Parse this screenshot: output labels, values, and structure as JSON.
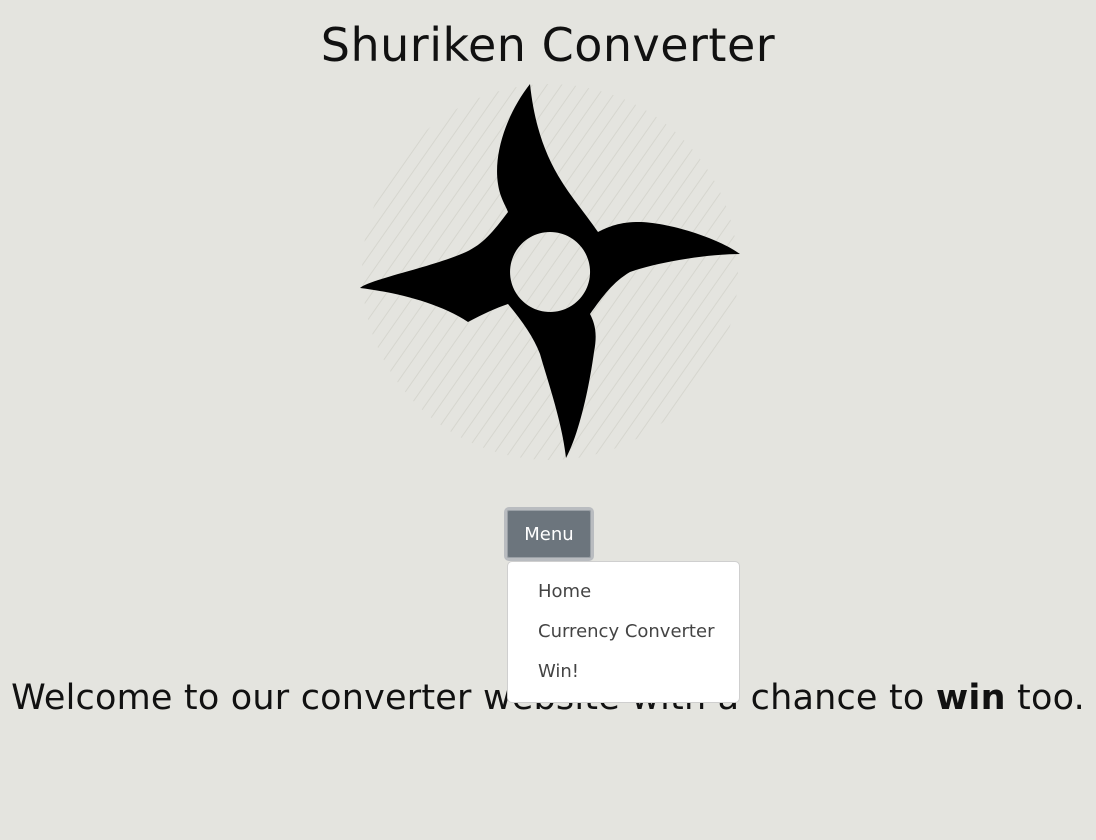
{
  "header": {
    "title": "Shuriken Converter"
  },
  "logo": {
    "icon": "shuriken-icon"
  },
  "menu": {
    "button_label": "Menu",
    "items": [
      {
        "label": "Home"
      },
      {
        "label": "Currency Converter"
      },
      {
        "label": "Win!"
      }
    ]
  },
  "welcome": {
    "before": "Welcome to our converter website with a chance to ",
    "bold": "win",
    "after": " too."
  },
  "colors": {
    "background": "#e4e4df",
    "button": "#6c757d",
    "text": "#111111"
  }
}
